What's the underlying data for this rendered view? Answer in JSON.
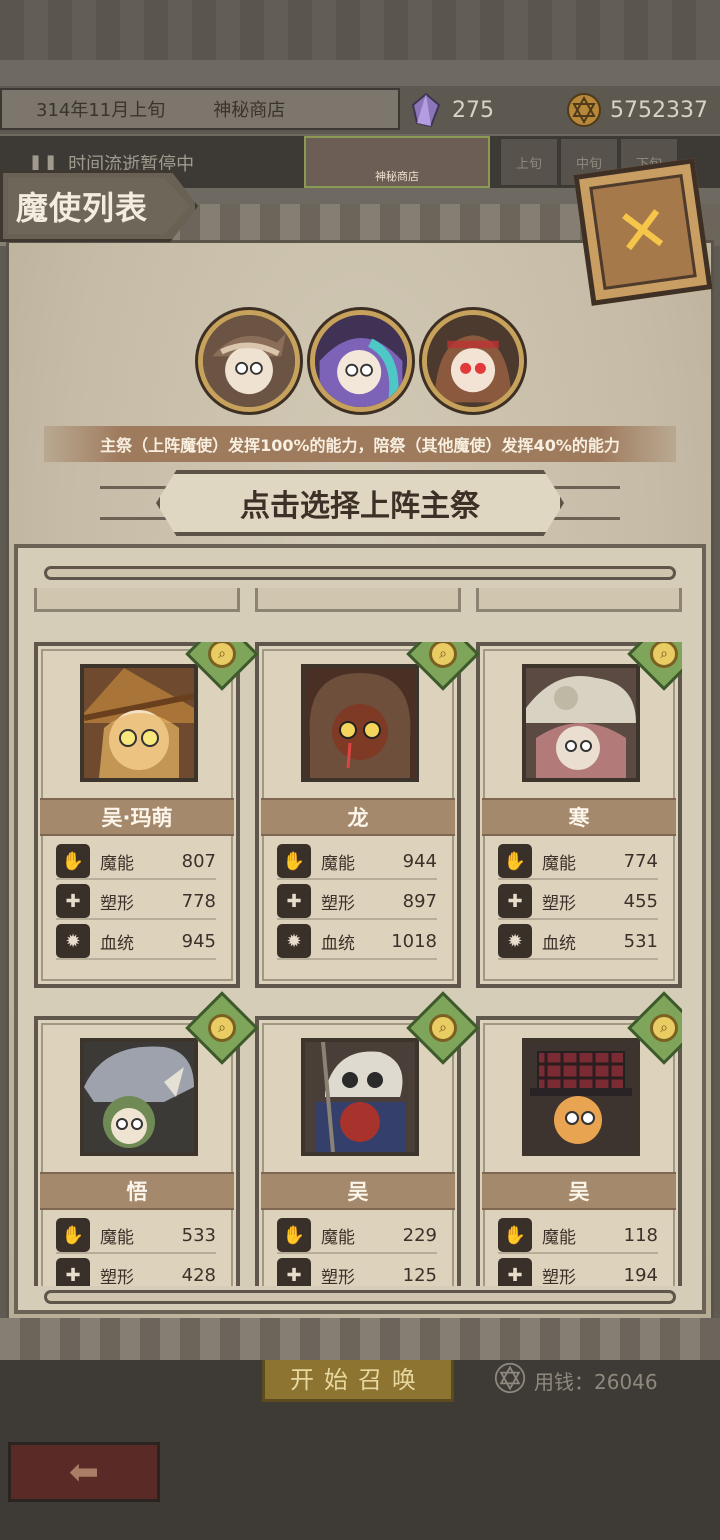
{
  "header": {
    "date": "314年11月上旬",
    "location": "神秘商店",
    "crystal_count": "275",
    "coin_count": "5752337"
  },
  "background": {
    "pause_text": "时间流逝暂停中",
    "shop_thumb_label": "神秘商店",
    "period_tabs": [
      "上旬",
      "中旬",
      "下旬"
    ],
    "summon_button": "开始召唤",
    "cost_text": "用钱：26046"
  },
  "modal": {
    "title": "魔使列表",
    "close_label": "✕",
    "info_text": "主祭（上阵魔使）发挥100%的能力，陪祭（其他魔使）发挥40%的能力",
    "select_prompt": "点击选择上阵主祭"
  },
  "team": [
    {
      "name": "吴·玛萌"
    },
    {
      "name": "紫发魔使"
    },
    {
      "name": "红眼魔使"
    }
  ],
  "stat_labels": {
    "magic": "魔能",
    "shape": "塑形",
    "blood": "血统"
  },
  "characters": [
    {
      "name": "吴·玛萌",
      "magic": "807",
      "shape": "778",
      "blood": "945"
    },
    {
      "name": "龙",
      "magic": "944",
      "shape": "897",
      "blood": "1018"
    },
    {
      "name": "寒",
      "magic": "774",
      "shape": "455",
      "blood": "531"
    },
    {
      "name": "悟",
      "magic": "533",
      "shape": "428",
      "blood": ""
    },
    {
      "name": "吴",
      "magic": "229",
      "shape": "125",
      "blood": ""
    },
    {
      "name": "吴",
      "magic": "118",
      "shape": "194",
      "blood": ""
    }
  ],
  "colors": {
    "parchment": "#d6cdb8",
    "name_bar": "#a4896c",
    "gold": "#c7a25c",
    "close_btn": "#c89e63"
  }
}
